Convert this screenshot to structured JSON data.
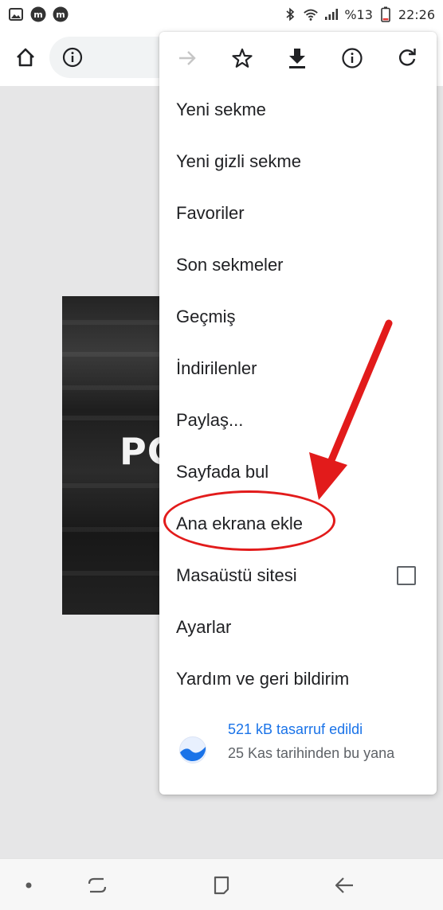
{
  "status_bar": {
    "left_icons": [
      "gallery-icon",
      "m-app-icon",
      "m-app-icon"
    ],
    "right_icons": [
      "bluetooth-icon",
      "wifi-icon",
      "signal-icon"
    ],
    "battery_percent": "%13",
    "time": "22:26"
  },
  "toolbar": {
    "home_icon": "home-icon",
    "site_info_icon": "info-icon"
  },
  "page": {
    "hero_text": "PC"
  },
  "menu": {
    "icon_row": [
      "forward-icon",
      "star-icon",
      "download-icon",
      "info-icon",
      "refresh-icon"
    ],
    "items": [
      {
        "label": "Yeni sekme"
      },
      {
        "label": "Yeni gizli sekme"
      },
      {
        "label": "Favoriler"
      },
      {
        "label": "Son sekmeler"
      },
      {
        "label": "Geçmiş"
      },
      {
        "label": "İndirilenler"
      },
      {
        "label": "Paylaş..."
      },
      {
        "label": "Sayfada bul"
      },
      {
        "label": "Ana ekrana ekle"
      },
      {
        "label": "Masaüstü sitesi",
        "checkbox_checked": false
      },
      {
        "label": "Ayarlar"
      },
      {
        "label": "Yardım ve geri bildirim"
      }
    ],
    "data_saver": {
      "title": "521 kB tasarruf edildi",
      "subtitle": "25 Kas tarihinden bu yana"
    }
  },
  "colors": {
    "accent_link": "#1a73e8",
    "annotation_red": "#e21b1b"
  }
}
